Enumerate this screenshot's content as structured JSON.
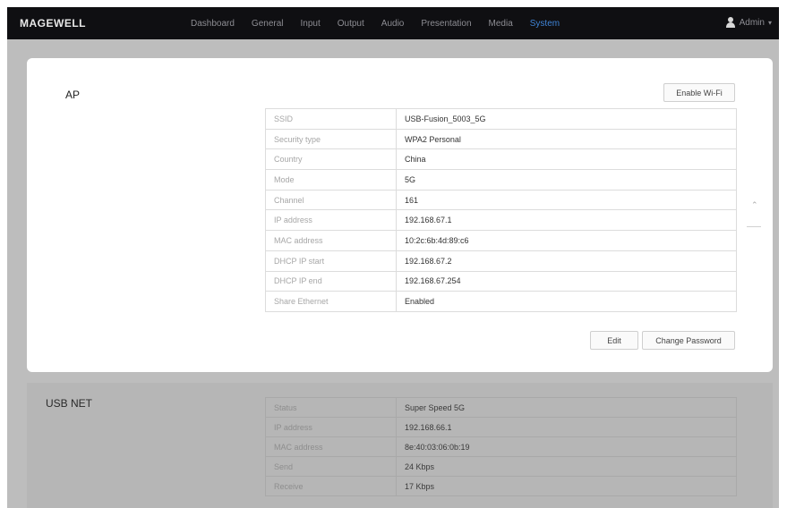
{
  "app": {
    "logo": "MAGEWELL"
  },
  "nav": {
    "items": [
      "Dashboard",
      "General",
      "Input",
      "Output",
      "Audio",
      "Presentation",
      "Media",
      "System"
    ],
    "active": "System"
  },
  "user": {
    "name": "Admin",
    "icon": "user-icon"
  },
  "ap": {
    "title": "AP",
    "enable_wifi_label": "Enable Wi-Fi",
    "rows": [
      {
        "key": "SSID",
        "value": "USB-Fusion_5003_5G"
      },
      {
        "key": "Security type",
        "value": "WPA2 Personal"
      },
      {
        "key": "Country",
        "value": "China"
      },
      {
        "key": "Mode",
        "value": "5G"
      },
      {
        "key": "Channel",
        "value": "161"
      },
      {
        "key": "IP address",
        "value": "192.168.67.1"
      },
      {
        "key": "MAC address",
        "value": "10:2c:6b:4d:89:c6"
      },
      {
        "key": "DHCP IP start",
        "value": "192.168.67.2"
      },
      {
        "key": "DHCP IP end",
        "value": "192.168.67.254"
      },
      {
        "key": "Share Ethernet",
        "value": "Enabled"
      }
    ],
    "edit_label": "Edit",
    "change_password_label": "Change Password"
  },
  "usb_net": {
    "title": "USB NET",
    "rows": [
      {
        "key": "Status",
        "value": "Super Speed 5G"
      },
      {
        "key": "IP address",
        "value": "192.168.66.1"
      },
      {
        "key": "MAC address",
        "value": "8e:40:03:06:0b:19"
      },
      {
        "key": "Send",
        "value": "24 Kbps"
      },
      {
        "key": "Receive",
        "value": "17 Kbps"
      }
    ]
  },
  "colors": {
    "topbar": "#0f0f12",
    "accent": "#3f84d6",
    "page_bg": "#bdbdbd"
  }
}
